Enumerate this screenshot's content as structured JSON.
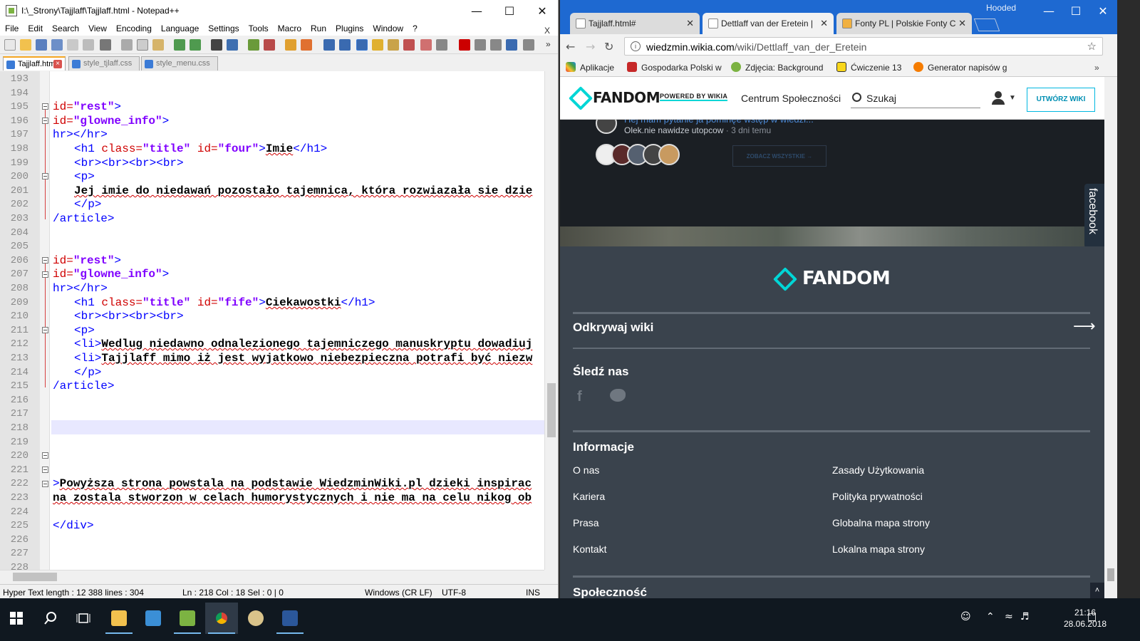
{
  "notepad": {
    "title": "I:\\_Strony\\Tajjlaff\\Tajjlaff.html - Notepad++",
    "menu": [
      "File",
      "Edit",
      "Search",
      "View",
      "Encoding",
      "Language",
      "Settings",
      "Tools",
      "Macro",
      "Run",
      "Plugins",
      "Window",
      "?"
    ],
    "menu_close": "X",
    "tabs": [
      {
        "label": "Tajjlaff.html",
        "active": true
      },
      {
        "label": "style_tjlaff.css",
        "active": false
      },
      {
        "label": "style_menu.css",
        "active": false
      }
    ],
    "line_numbers": [
      "193",
      "194",
      "195",
      "196",
      "197",
      "198",
      "199",
      "200",
      "201",
      "202",
      "203",
      "204",
      "205",
      "206",
      "207",
      "208",
      "209",
      "210",
      "211",
      "212",
      "213",
      "214",
      "215",
      "216",
      "217",
      "218",
      "219",
      "220",
      "221",
      "222",
      "223",
      "224",
      "225",
      "226",
      "227",
      "228"
    ],
    "code": {
      "l195_attr": "id=",
      "l195_val": "\"rest\"",
      "l195_end": ">",
      "l196_attr": "id=",
      "l196_val": "\"glowne_info\"",
      "l196_end": ">",
      "l197": "hr></hr>",
      "l198_a": "<h1 ",
      "l198_b": "class=",
      "l198_c": "\"title\"",
      "l198_d": " id=",
      "l198_e": "\"four\"",
      "l198_f": ">",
      "l198_g": "Imie",
      "l198_h": "</h1>",
      "l199": "<br><br><br><br>",
      "l200": "<p>",
      "l201": "Jej imie do niedawań pozostało tajemnica, która rozwiazała sie dzie",
      "l202": "</p>",
      "l203": "/article>",
      "l206_attr": "id=",
      "l206_val": "\"rest\"",
      "l206_end": ">",
      "l207_attr": "id=",
      "l207_val": "\"glowne_info\"",
      "l207_end": ">",
      "l208": "hr></hr>",
      "l209_a": "<h1 ",
      "l209_b": "class=",
      "l209_c": "\"title\"",
      "l209_d": " id=",
      "l209_e": "\"fife\"",
      "l209_f": ">",
      "l209_g": "Ciekawostki",
      "l209_h": "</h1>",
      "l210": "<br><br><br><br>",
      "l211": "<p>",
      "l212_tag": "<li>",
      "l212_txt": "Wedlug niedawno odnalezionego tajemniczego manuskryptu dowadiuj",
      "l213_tag": "<li>",
      "l213_txt": "Tajjlaff mimo iż jest wyjatkowo niebezpieczna potrafi być niezw",
      "l214": "</p>",
      "l215": "/article>",
      "l222_tag": ">",
      "l222_txt": "Powyższa strona powstala na podstawie WiedzminWiki.pl dzieki inspirac",
      "l223": "na zostala stworzon w celach humorystycznych i nie ma na celu nikog ob",
      "l225": "</div>"
    },
    "status": {
      "type": "Hyper Text length : 12 388    lines : 304",
      "pos": "Ln : 218    Col : 18    Sel : 0 | 0",
      "eol": "Windows (CR LF)",
      "enc": "UTF-8",
      "mode": "INS"
    }
  },
  "chrome": {
    "profile": "Hooded",
    "tabs": [
      {
        "label": "Tajjlaff.html#",
        "active": false
      },
      {
        "label": "Dettlaff van der Eretein |",
        "active": true
      },
      {
        "label": "Fonty PL | Polskie Fonty C",
        "active": false
      }
    ],
    "url_host": "wiedzmin.wikia.com",
    "url_path": "/wiki/Dettlaff_van_der_Eretein",
    "bookmarks": [
      "Aplikacje",
      "Gospodarka Polski w",
      "Zdjęcia: Background",
      "Ćwiczenie 13",
      "Generator napisów g"
    ],
    "fandom": {
      "logo": "FANDOM",
      "powered": "POWERED BY WIKIA",
      "community": "Centrum Społeczności",
      "search_placeholder": "Szukaj",
      "create": "UTWÓRZ WIKI",
      "question": "Hej mam pytanie ja pominęe wstęp w wiedzi...",
      "author": "Olek.nie nawidze utopcow",
      "when": " · 3 dni temu",
      "see_all": "ZOBACZ WSZYSTKIE →",
      "facebook_tab": "facebook",
      "footer_logo": "FANDOM",
      "explore": "Odkrywaj wiki",
      "follow": "Śledź nas",
      "info": "Informacje",
      "links_left": [
        "O nas",
        "Kariera",
        "Prasa",
        "Kontakt"
      ],
      "links_right": [
        "Zasady Użytkowania",
        "Polityka prywatności",
        "Globalna mapa strony",
        "Lokalna mapa strony"
      ],
      "community_head": "Społeczność"
    }
  },
  "taskbar": {
    "time": "21:16",
    "date": "28.06.2018"
  }
}
